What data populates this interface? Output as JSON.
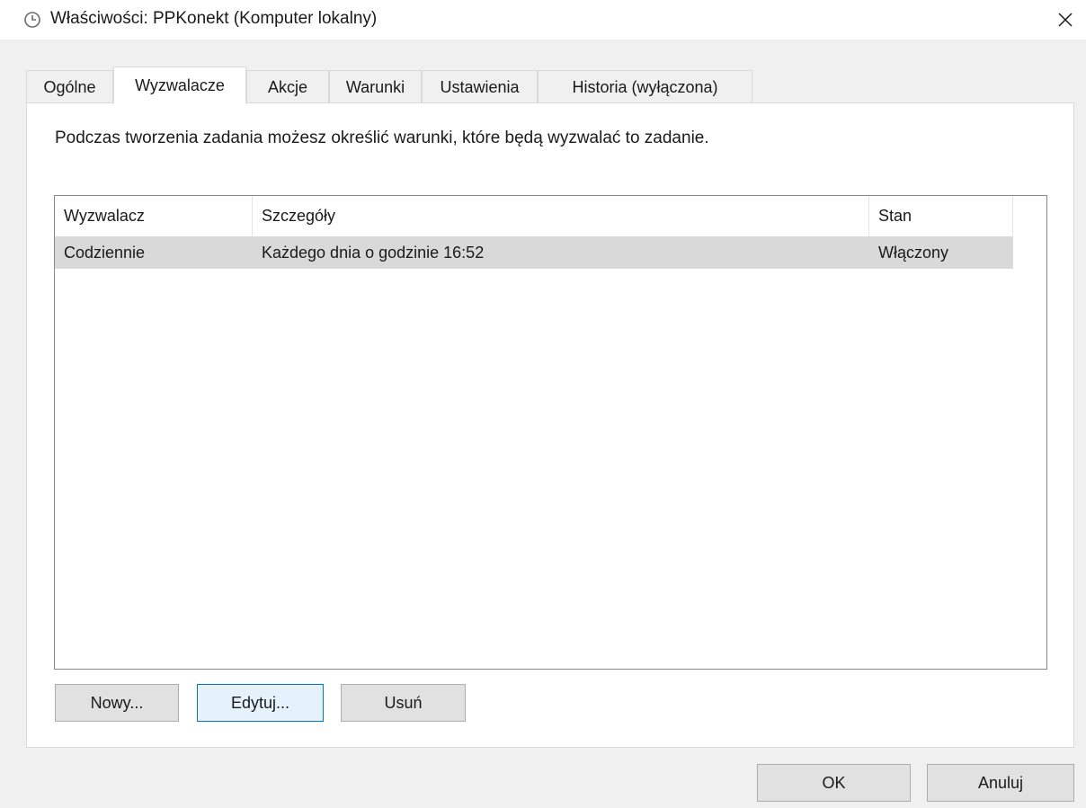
{
  "window": {
    "title": "Właściwości: PPKonekt (Komputer lokalny)",
    "close_glyph": "✕",
    "icon": "clock-icon"
  },
  "tabs": [
    {
      "label": "Ogólne"
    },
    {
      "label": "Wyzwalacze"
    },
    {
      "label": "Akcje"
    },
    {
      "label": "Warunki"
    },
    {
      "label": "Ustawienia"
    },
    {
      "label": "Historia (wyłączona)"
    }
  ],
  "active_tab": "Wyzwalacze",
  "panel": {
    "description": "Podczas tworzenia zadania możesz określić warunki, które będą wyzwalać to zadanie."
  },
  "triggers_table": {
    "columns": [
      "Wyzwalacz",
      "Szczegóły",
      "Stan"
    ],
    "rows": [
      {
        "trigger": "Codziennie",
        "details": "Każdego dnia o godzinie 16:52",
        "state": "Włączony"
      }
    ]
  },
  "panel_buttons": {
    "new_label": "Nowy...",
    "edit_label": "Edytuj...",
    "delete_label": "Usuń"
  },
  "dialog_buttons": {
    "ok_label": "OK",
    "cancel_label": "Anuluj"
  },
  "colors": {
    "selected_row": "#d9d9d9",
    "focus_border": "#0078d7"
  }
}
